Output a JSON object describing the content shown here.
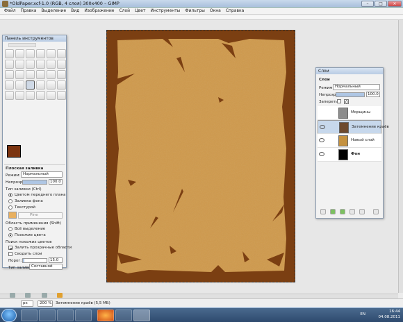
{
  "window": {
    "title": "*OldPaper.xcf-1.0 (RGB, 4 слоя) 300x400 – GIMP"
  },
  "menubar": [
    "Файл",
    "Правка",
    "Выделение",
    "Вид",
    "Изображение",
    "Слой",
    "Цвет",
    "Инструменты",
    "Фильтры",
    "Окна",
    "Справка"
  ],
  "toolbox": {
    "title": "Панель инструментов",
    "tool_name": "Плоская заливка",
    "mode_label": "Режим:",
    "mode_value": "Нормальный",
    "opacity_label": "Непрозр.",
    "opacity_value": "100.0",
    "fill_type_label": "Тип заливки (Ctrl)",
    "fill_options": [
      "Цветом переднего плана",
      "Заливка фона",
      "Текстурой"
    ],
    "pattern_name": "Pine",
    "area_label": "Область применения (Shift)",
    "area_options": [
      "Всё выделение",
      "Похожие цвета"
    ],
    "search_label": "Поиск похожих цветов",
    "transparent_check": "Залить прозрачные области",
    "merged_check": "Сводить слои",
    "threshold_label": "Порог:",
    "threshold_value": "15.0",
    "fill_by_label": "Тип заливки",
    "fill_by_value": "Составной",
    "fg_color": "#7b3410",
    "bg_color": "#ffffff"
  },
  "layers": {
    "title": "Слои",
    "tab": "Слои",
    "mode_label": "Режим:",
    "mode_value": "Нормальный",
    "opacity_label": "Непрозр.",
    "opacity_value": "100.0",
    "lock_label": "Запереть:",
    "items": [
      {
        "name": "Морщины",
        "visible": false,
        "thumb": "#8c8c8c"
      },
      {
        "name": "Затемнение краёв",
        "visible": true,
        "thumb": "#6e4a2e"
      },
      {
        "name": "Новый слой",
        "visible": true,
        "thumb": "#c4913f"
      },
      {
        "name": "Фон",
        "visible": true,
        "thumb": "#000000"
      }
    ]
  },
  "status": {
    "unit": "px",
    "zoom": "200 %",
    "message": "Затемнение краёв (5,5 МБ)"
  },
  "tray": {
    "lang": "EN",
    "time": "16:44",
    "date": "04.08.2011"
  },
  "colors": {
    "paper": "#d09a4c",
    "frame": "#7b3f12"
  }
}
